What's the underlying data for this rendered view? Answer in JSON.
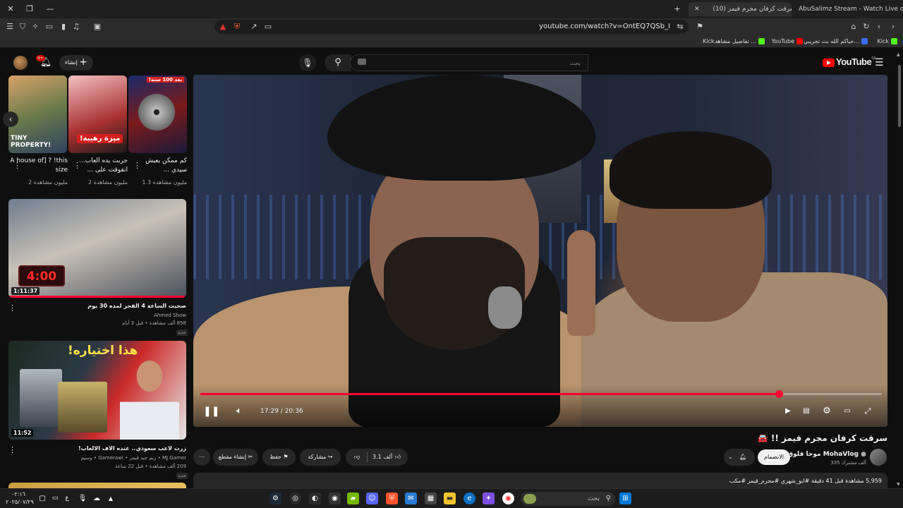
{
  "browser": {
    "tabs": [
      {
        "label": "(10) سرقت كرفان مجرم قيمز !! 🚘",
        "active": true
      },
      {
        "label": "AbuSalimz Stream - Watch Live on K",
        "active": false
      }
    ],
    "url": "youtube.com/watch?v=OntEQ7QSb_I",
    "bookmarks": [
      {
        "label": "Kick"
      },
      {
        "label": "حياكم الله بث تجريبي..."
      },
      {
        "label": "YouTube"
      },
      {
        "label": "تفاصيل مشاهد ..."
      },
      {
        "label": "Kick -"
      }
    ]
  },
  "header": {
    "logo": "YouTube",
    "logo_region": "SA",
    "search_placeholder": "بحث",
    "create_label": "إنشاء",
    "notif_count": "9+"
  },
  "shorts": [
    {
      "title": "A house of] ? !this size",
      "views": "2 مليون مشاهدة",
      "thumb_text": "TINY PROPERTY!"
    },
    {
      "title": "جربت يده العاب... انقوقت على ...",
      "views": "2 مليون مشاهدة",
      "thumb_text": "ميزة رهيبة!"
    },
    {
      "title": "كم ممكن يعيش سيدي ...",
      "views": "1.3 مليون مشاهدة",
      "thumb_text": "بعد 100 سنة!"
    }
  ],
  "recommendations": [
    {
      "duration": "1:11:37",
      "title": "صحيت الساعة 4 الفجر لمده 30 يوم",
      "channel": "Ahmed Show",
      "meta": "858 ألف مشاهدة • قبل 3 أيام",
      "badge": "جديد",
      "thumb_text": "4:00"
    },
    {
      "duration": "11:52",
      "title": "زرت لاعب سعودي.. عنده الاف الالعاب!",
      "channel": "MJ Gamer • ريم جيد قيمز • Gamerawi • وسيم",
      "meta": "209 ألف مشاهدة • قبل 22 ساعة",
      "badge": "جديد",
      "thumb_text": "هذا اختياره!"
    }
  ],
  "player": {
    "current_time": "17:29",
    "total_time": "20:36",
    "progress": 0.849
  },
  "video": {
    "title": "سرقت كرفان مجرم قيمز !! 🚘",
    "channel": "موحا فلوق MohaVlog",
    "subscribers": "335 ألف مشترك",
    "subscribe_label": "الانضمام",
    "likes": "3.1 ألف",
    "share_label": "مشاركة",
    "save_label": "حفظ",
    "clip_label": "إنشاء مقطع",
    "description": "5,959 مشاهدة قبل 41 دقيقة #ابو_شهري #مجرم_قيمز #مكب"
  },
  "taskbar": {
    "search_placeholder": "بحث",
    "time": "٠٢:١٦",
    "date": "٢٠٢٥/٠٧/٢٩",
    "lang": "ع"
  },
  "colors": {
    "accent": "#ff0033",
    "background": "#0f0f0f"
  }
}
